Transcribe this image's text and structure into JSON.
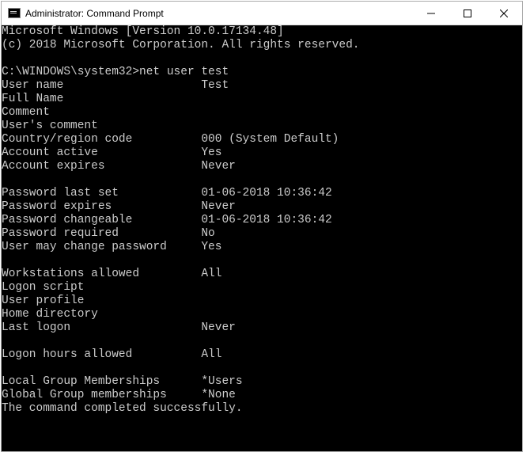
{
  "window": {
    "title": "Administrator: Command Prompt"
  },
  "terminal": {
    "header1": "Microsoft Windows [Version 10.0.17134.48]",
    "header2": "(c) 2018 Microsoft Corporation. All rights reserved.",
    "prompt_path": "C:\\WINDOWS\\system32>",
    "command": "net user test",
    "fields": {
      "user_name": {
        "label": "User name",
        "value": "Test"
      },
      "full_name": {
        "label": "Full Name",
        "value": ""
      },
      "comment": {
        "label": "Comment",
        "value": ""
      },
      "users_comment": {
        "label": "User's comment",
        "value": ""
      },
      "country_region": {
        "label": "Country/region code",
        "value": "000 (System Default)"
      },
      "account_active": {
        "label": "Account active",
        "value": "Yes"
      },
      "account_expires": {
        "label": "Account expires",
        "value": "Never"
      },
      "pw_last_set": {
        "label": "Password last set",
        "value": "01-06-2018 10:36:42"
      },
      "pw_expires": {
        "label": "Password expires",
        "value": "Never"
      },
      "pw_changeable": {
        "label": "Password changeable",
        "value": "01-06-2018 10:36:42"
      },
      "pw_required": {
        "label": "Password required",
        "value": "No"
      },
      "user_may_change": {
        "label": "User may change password",
        "value": "Yes"
      },
      "workstations": {
        "label": "Workstations allowed",
        "value": "All"
      },
      "logon_script": {
        "label": "Logon script",
        "value": ""
      },
      "user_profile": {
        "label": "User profile",
        "value": ""
      },
      "home_dir": {
        "label": "Home directory",
        "value": ""
      },
      "last_logon": {
        "label": "Last logon",
        "value": "Never"
      },
      "logon_hours": {
        "label": "Logon hours allowed",
        "value": "All"
      },
      "local_groups": {
        "label": "Local Group Memberships",
        "value": "*Users"
      },
      "global_groups": {
        "label": "Global Group memberships",
        "value": "*None"
      }
    },
    "finish": "The command completed successfully."
  }
}
